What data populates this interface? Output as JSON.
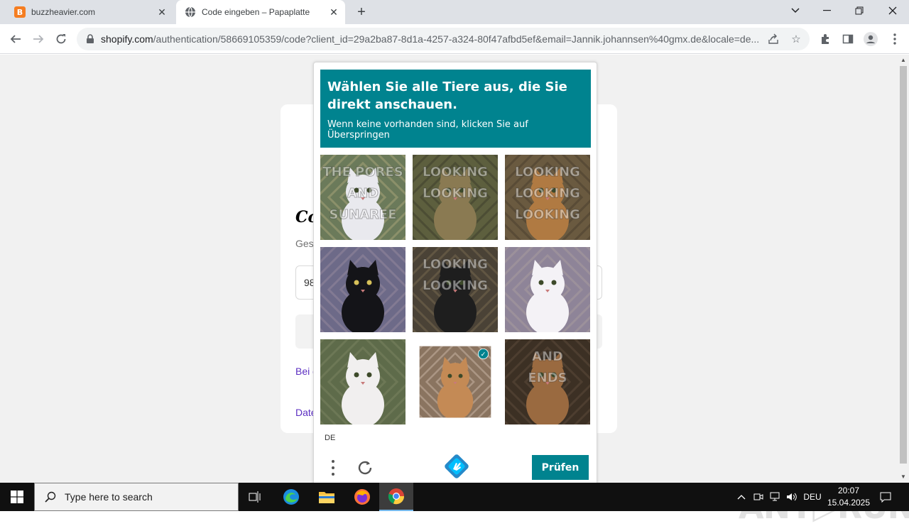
{
  "browser": {
    "tabs": [
      {
        "title": "buzzheavier.com",
        "favicon": "B"
      },
      {
        "title": "Code eingeben – Papaplatte"
      }
    ],
    "url_host": "shopify.com",
    "url_path": "/authentication/58669105359/code?client_id=29a2ba87-8d1a-4257-a324-80f47afbd5ef&email=Jannik.johannsen%40gmx.de&locale=de..."
  },
  "page": {
    "heading": "Co",
    "subtitle": "Ges",
    "code_value": "98",
    "link1": "Bei d",
    "link2": "Date"
  },
  "captcha": {
    "prompt_title": "Wählen Sie alle Tiere aus, die Sie direkt anschauen.",
    "prompt_subtitle": "Wenn keine vorhanden sind, klicken Sie auf Überspringen",
    "language": "DE",
    "submit_label": "Prüfen",
    "accent_color": "#00838f",
    "tiles": [
      {
        "selected": false,
        "overlay_text": [
          "THE PORES",
          "AND",
          "SUNAREE"
        ]
      },
      {
        "selected": false,
        "overlay_text": [
          "LOOKING",
          "LOOKING"
        ]
      },
      {
        "selected": false,
        "overlay_text": [
          "LOOKING",
          "LOOKING",
          "LOOKING"
        ]
      },
      {
        "selected": false,
        "overlay_text": []
      },
      {
        "selected": false,
        "overlay_text": [
          "LOOKING",
          "LOOKING"
        ]
      },
      {
        "selected": false,
        "overlay_text": []
      },
      {
        "selected": false,
        "overlay_text": []
      },
      {
        "selected": true,
        "overlay_text": []
      },
      {
        "selected": false,
        "overlay_text": [
          "AND",
          "ENDS"
        ]
      }
    ]
  },
  "watermark": "ANY▷RUN",
  "taskbar": {
    "search_placeholder": "Type here to search",
    "language": "DEU",
    "time": "20:07",
    "date": "15.04.2025"
  }
}
